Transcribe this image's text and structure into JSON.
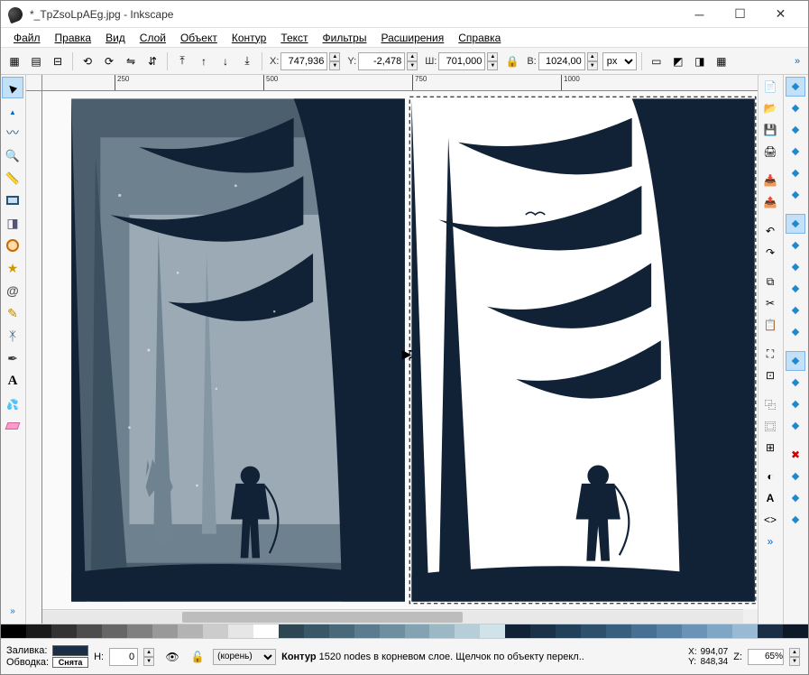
{
  "window": {
    "title": "*_TpZsoLpAEg.jpg - Inkscape"
  },
  "menu": {
    "items": [
      "Файл",
      "Правка",
      "Вид",
      "Слой",
      "Объект",
      "Контур",
      "Текст",
      "Фильтры",
      "Расширения",
      "Справка"
    ]
  },
  "toolbar": {
    "x_label": "X:",
    "x_value": "747,936",
    "y_label": "Y:",
    "y_value": "-2,478",
    "w_label": "Ш:",
    "w_value": "701,000",
    "h_label": "В:",
    "h_value": "1024,00",
    "unit": "px"
  },
  "ruler_h": [
    "250",
    "500",
    "750",
    "1000"
  ],
  "ruler_v": [],
  "status": {
    "fill_label": "Заливка:",
    "stroke_label": "Обводка:",
    "stroke_value": "Снята",
    "n_label": "Н:",
    "n_value": "0",
    "layer": "(корень)",
    "message_prefix": "Контур",
    "message": "1520 nodes в корневом слое. Щелчок по объекту перекл..",
    "x_label": "X:",
    "x_value": "994,07",
    "y_label": "Y:",
    "y_value": "848,34",
    "z_label": "Z:",
    "zoom": "65%"
  },
  "palette": [
    "#000000",
    "#1a1a1a",
    "#333333",
    "#4d4d4d",
    "#666666",
    "#808080",
    "#999999",
    "#b3b3b3",
    "#cccccc",
    "#e6e6e6",
    "#ffffff",
    "#2d4654",
    "#3a5767",
    "#49697a",
    "#5a7c8e",
    "#6e8fa0",
    "#84a3b2",
    "#9cb8c4",
    "#b5ced7",
    "#d0e3ea",
    "#122236",
    "#1a3148",
    "#23405a",
    "#2d506d",
    "#395f7f",
    "#477092",
    "#5781a4",
    "#6a93b5",
    "#80a6c5",
    "#99bad4",
    "#1a2f45",
    "#0d1926"
  ],
  "artwork": {
    "bg_left": "#4c5f6e",
    "mid_left": "#8697a4",
    "fog_left": "#c8d3da",
    "dark": "#122236",
    "bg_right": "#ffffff"
  }
}
